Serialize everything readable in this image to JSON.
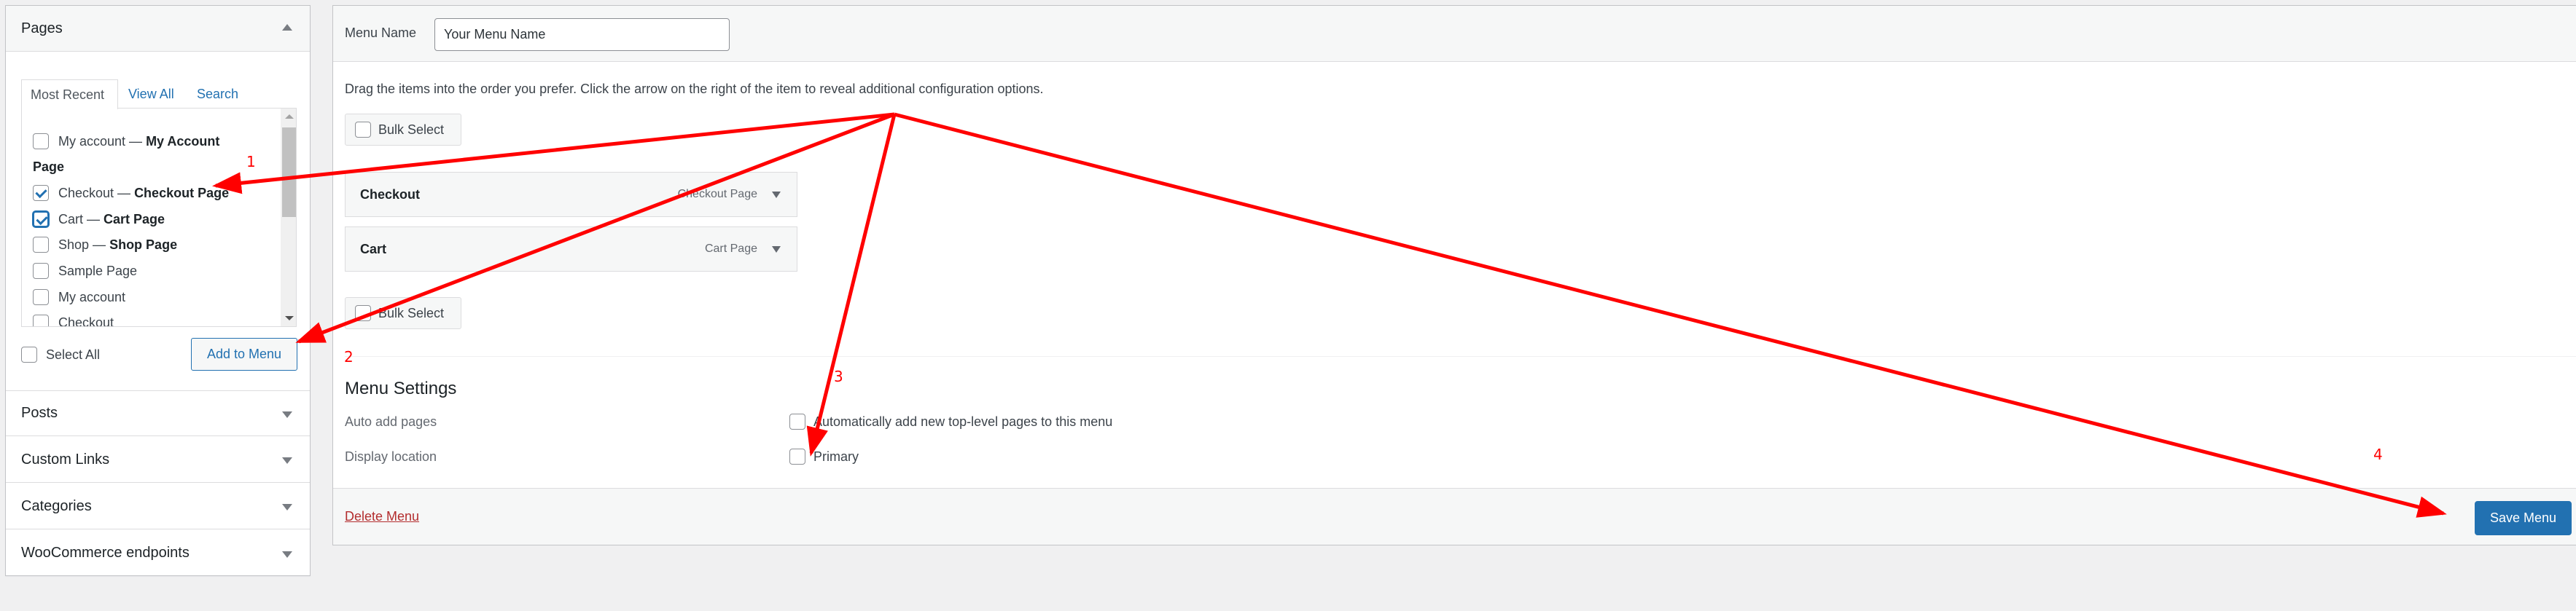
{
  "left_panel": {
    "pages": {
      "title": "Pages",
      "tabs": [
        {
          "label": "Most Recent",
          "active": true
        },
        {
          "label": "View All",
          "active": false
        },
        {
          "label": "Search",
          "active": false
        }
      ],
      "items": [
        {
          "type": "item",
          "label": "My account",
          "sep": " — ",
          "bold": "My Account",
          "checked": false
        },
        {
          "type": "group",
          "label": "Page"
        },
        {
          "type": "item",
          "label": "Checkout",
          "sep": " — ",
          "bold": "Checkout Page",
          "checked": true
        },
        {
          "type": "item",
          "label": "Cart",
          "sep": " — ",
          "bold": "Cart Page",
          "checked": true,
          "focused": true
        },
        {
          "type": "item",
          "label": "Shop",
          "sep": " — ",
          "bold": "Shop Page",
          "checked": false
        },
        {
          "type": "item",
          "label": "Sample Page",
          "sep": "",
          "bold": "",
          "checked": false
        },
        {
          "type": "item",
          "label": "My account",
          "sep": "",
          "bold": "",
          "checked": false
        },
        {
          "type": "item",
          "label": "Checkout",
          "sep": "",
          "bold": "",
          "checked": false
        }
      ],
      "select_all_label": "Select All",
      "add_button": "Add to Menu"
    },
    "collapsed_sections": [
      {
        "title": "Posts"
      },
      {
        "title": "Custom Links"
      },
      {
        "title": "Categories"
      },
      {
        "title": "WooCommerce endpoints"
      }
    ]
  },
  "main": {
    "menu_name_label": "Menu Name",
    "menu_name_value": "Your Menu Name",
    "drag_hint": "Drag the items into the order you prefer. Click the arrow on the right of the item to reveal additional configuration options.",
    "bulk_select_label": "Bulk Select",
    "menu_items": [
      {
        "title": "Checkout",
        "type": "Checkout Page"
      },
      {
        "title": "Cart",
        "type": "Cart Page"
      }
    ],
    "settings": {
      "heading": "Menu Settings",
      "auto_add_label": "Auto add pages",
      "auto_add_option": "Automatically add new top-level pages to this menu",
      "auto_add_checked": false,
      "display_location_label": "Display location",
      "display_location_option": "Primary",
      "display_location_checked": false
    },
    "delete_label": "Delete Menu",
    "save_label": "Save Menu"
  },
  "annotations": {
    "color": "#ff0000",
    "steps": [
      "1",
      "2",
      "3",
      "4"
    ]
  }
}
